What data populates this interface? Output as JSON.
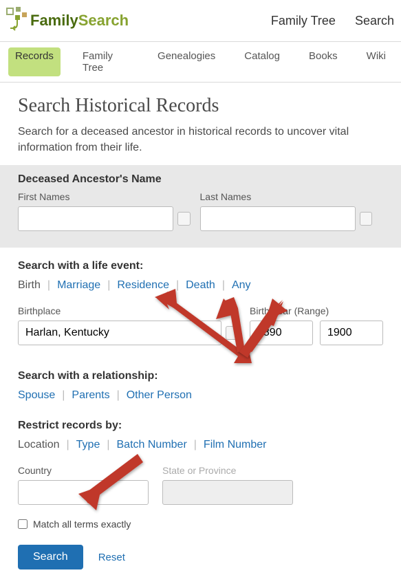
{
  "header": {
    "logo_family": "Family",
    "logo_search": "Search",
    "topnav": [
      "Family Tree",
      "Search"
    ]
  },
  "tabs": [
    "Records",
    "Family Tree",
    "Genealogies",
    "Catalog",
    "Books",
    "Wiki"
  ],
  "active_tab": "Records",
  "page": {
    "title": "Search Historical Records",
    "intro": "Search for a deceased ancestor in historical records to uncover vital information from their life."
  },
  "name_section": {
    "heading": "Deceased Ancestor's Name",
    "first_label": "First Names",
    "last_label": "Last Names",
    "first_value": "",
    "last_value": ""
  },
  "life_event": {
    "heading": "Search with a life event:",
    "selected": "Birth",
    "links": [
      "Marriage",
      "Residence",
      "Death",
      "Any"
    ],
    "place_label": "Birthplace",
    "place_value": "Harlan, Kentucky",
    "year_label": "Birth Year (Range)",
    "year_from": "1890",
    "year_to": "1900"
  },
  "relationship": {
    "heading": "Search with a relationship:",
    "links": [
      "Spouse",
      "Parents",
      "Other Person"
    ]
  },
  "restrict": {
    "heading": "Restrict records by:",
    "selected": "Location",
    "links": [
      "Type",
      "Batch Number",
      "Film Number"
    ],
    "country_label": "Country",
    "country_value": "",
    "state_label": "State or Province",
    "state_value": ""
  },
  "match_label": "Match all terms exactly",
  "buttons": {
    "search": "Search",
    "reset": "Reset"
  }
}
